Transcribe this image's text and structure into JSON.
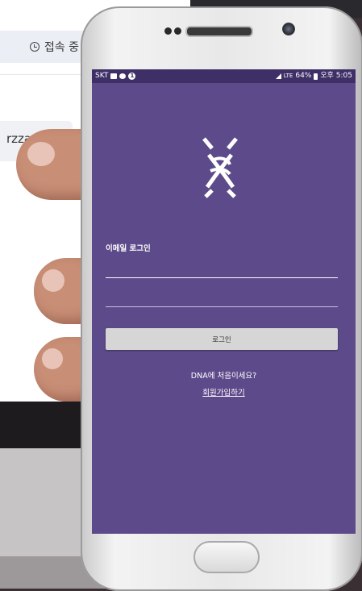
{
  "background": {
    "status_label": "접속 중",
    "username_fragment": "rzzang"
  },
  "status_bar": {
    "carrier": "SKT",
    "notification_count": "1",
    "network": "LTE",
    "battery": "64%",
    "time": "오후 5:05"
  },
  "login": {
    "title": "이메일 로그인",
    "email_value": "",
    "password_value": "",
    "button_label": "로그인"
  },
  "signup": {
    "prompt": "DNA에 처음이세요?",
    "link_label": "회원가입하기"
  },
  "colors": {
    "screen_background": "#5d4a8a",
    "status_bar": "#3e2f67",
    "button": "#d6d6d6"
  },
  "icons": [
    "clock-icon",
    "dna-logo-icon",
    "signal-icon",
    "battery-icon",
    "chat-icon",
    "image-icon"
  ]
}
